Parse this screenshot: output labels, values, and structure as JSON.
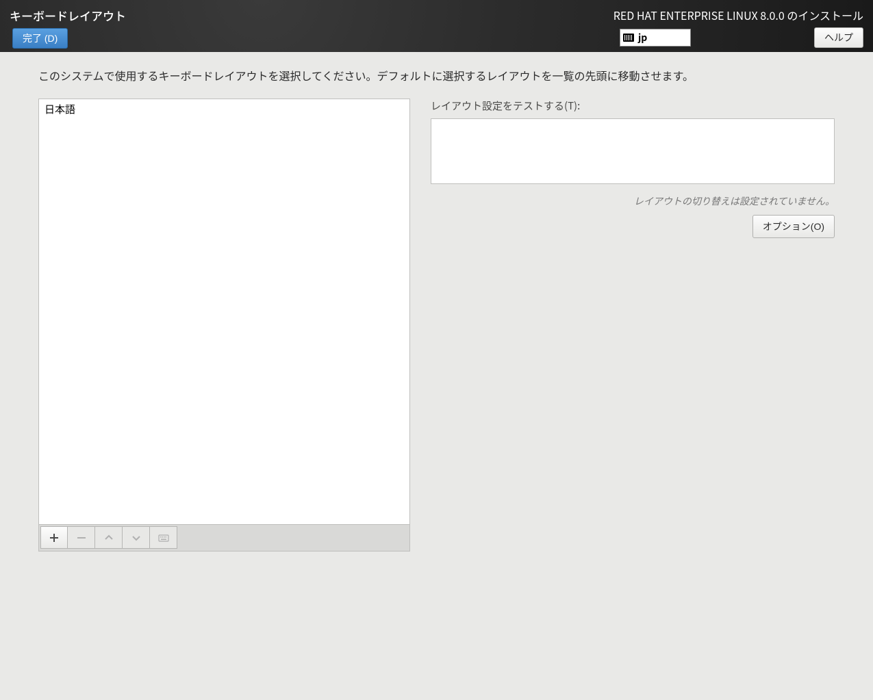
{
  "header": {
    "page_title": "キーボードレイアウト",
    "done_button": "完了 (D)",
    "distro_title": "RED HAT ENTERPRISE LINUX 8.0.0 のインストール",
    "lang_code": "jp",
    "help_button": "ヘルプ"
  },
  "instruction": "このシステムで使用するキーボードレイアウトを選択してください。デフォルトに選択するレイアウトを一覧の先頭に移動させます。",
  "layout_list": {
    "items": [
      "日本語"
    ]
  },
  "right": {
    "test_label": "レイアウト設定をテストする(T):",
    "switch_note": "レイアウトの切り替えは設定されていません。",
    "options_button": "オプション(O)"
  },
  "toolbar": {
    "add": "plus-icon",
    "remove": "minus-icon",
    "up": "chevron-up-icon",
    "down": "chevron-down-icon",
    "keyboard": "keyboard-icon"
  }
}
